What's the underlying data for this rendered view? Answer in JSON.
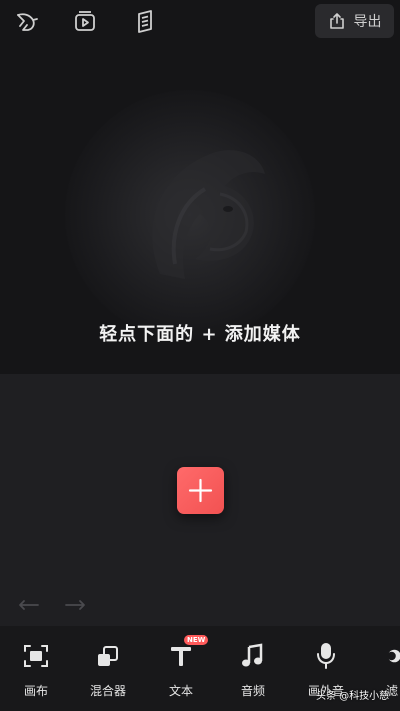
{
  "topbar": {
    "icons": [
      "bird-logo-icon",
      "play-template-icon",
      "tutorial-book-icon"
    ],
    "export_label": "导出"
  },
  "preview": {
    "hint": "轻点下面的 + 添加媒体"
  },
  "timeline": {
    "add_label": "+"
  },
  "toolbar": {
    "items": [
      {
        "label": "画布",
        "icon": "canvas-icon"
      },
      {
        "label": "混合器",
        "icon": "mixer-icon"
      },
      {
        "label": "文本",
        "icon": "text-icon",
        "badge": "NEW"
      },
      {
        "label": "音频",
        "icon": "audio-icon"
      },
      {
        "label": "画外音",
        "icon": "microphone-icon"
      },
      {
        "label": "滤",
        "icon": "filter-icon"
      }
    ]
  },
  "watermark": "头条 @科技小慈",
  "colors": {
    "accent": "#f25252",
    "background": "#1a1a1d"
  }
}
